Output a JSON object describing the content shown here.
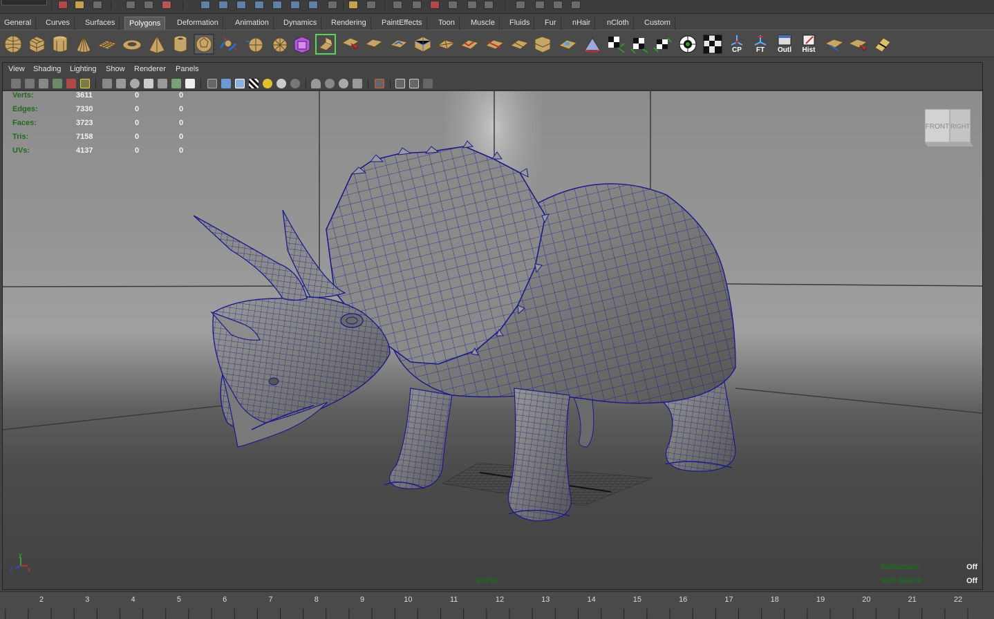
{
  "shelf": {
    "tabs": [
      {
        "label": "General"
      },
      {
        "label": "Curves"
      },
      {
        "label": "Surfaces"
      },
      {
        "label": "Polygons"
      },
      {
        "label": "Deformation"
      },
      {
        "label": "Animation"
      },
      {
        "label": "Dynamics"
      },
      {
        "label": "Rendering"
      },
      {
        "label": "PaintEffects"
      },
      {
        "label": "Toon"
      },
      {
        "label": "Muscle"
      },
      {
        "label": "Fluids"
      },
      {
        "label": "Fur"
      },
      {
        "label": "nHair"
      },
      {
        "label": "nCloth"
      },
      {
        "label": "Custom"
      }
    ],
    "active_tab": "Polygons",
    "text_buttons": {
      "cp": "CP",
      "ft": "FT",
      "outl": "Outl",
      "hist": "Hist"
    }
  },
  "panel": {
    "menu": [
      {
        "label": "View"
      },
      {
        "label": "Shading"
      },
      {
        "label": "Lighting"
      },
      {
        "label": "Show"
      },
      {
        "label": "Renderer"
      },
      {
        "label": "Panels"
      }
    ]
  },
  "hud": {
    "stats": [
      {
        "label": "Verts:",
        "values": [
          "3611",
          "0",
          "0"
        ]
      },
      {
        "label": "Edges:",
        "values": [
          "7330",
          "0",
          "0"
        ]
      },
      {
        "label": "Faces:",
        "values": [
          "3723",
          "0",
          "0"
        ]
      },
      {
        "label": "Tris:",
        "values": [
          "7158",
          "0",
          "0"
        ]
      },
      {
        "label": "UVs:",
        "values": [
          "4137",
          "0",
          "0"
        ]
      }
    ],
    "camera": "persp",
    "reflection": {
      "label": "Reflection:",
      "value": "Off"
    },
    "soft_select": {
      "label": "Soft Select:",
      "value": "Off"
    },
    "view_cube": {
      "front": "FRONT",
      "right": "RIGHT"
    },
    "axis": {
      "x": "x",
      "y": "y",
      "z": "z"
    }
  },
  "timeline": {
    "labels": [
      "2",
      "3",
      "4",
      "5",
      "6",
      "7",
      "8",
      "9",
      "10",
      "11",
      "12",
      "13",
      "14",
      "15",
      "16",
      "17",
      "18",
      "19",
      "20",
      "21",
      "22"
    ]
  },
  "colors": {
    "hud_label": "#1e6b1e",
    "wireframe": "#1a1a8c",
    "panel_bg": "#444444"
  }
}
